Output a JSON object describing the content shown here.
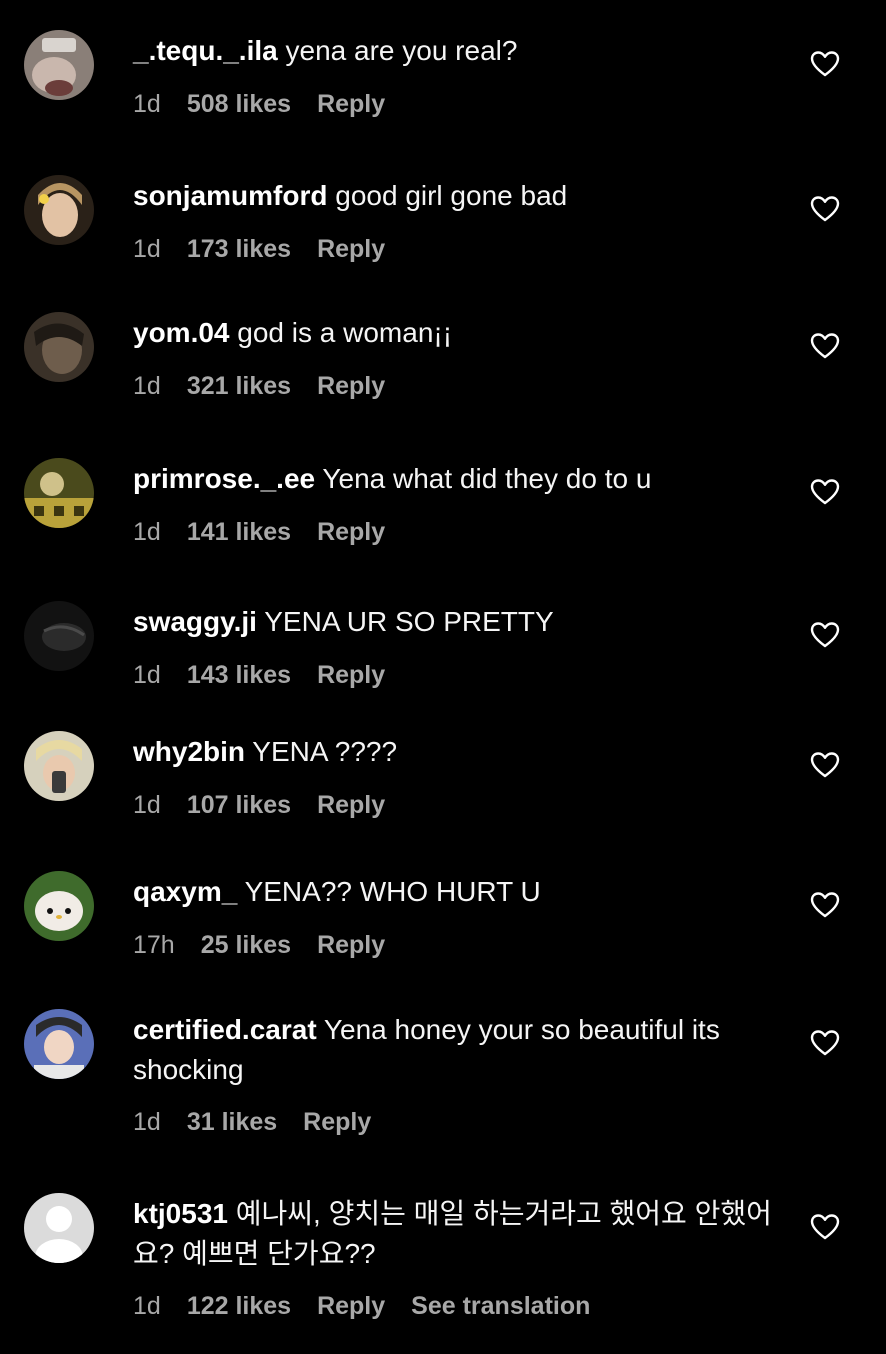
{
  "colors": {
    "background": "#000000",
    "text": "#f5f5f5",
    "secondary_text": "#a8a8a8",
    "heart_outline": "#ffffff"
  },
  "icons": {
    "like": "heart-outline-icon",
    "default_avatar": "default-profile-icon"
  },
  "comments": [
    {
      "username": "_.tequ._.ila",
      "text": "yena are you real?",
      "time": "1d",
      "likes": "508 likes",
      "reply": "Reply"
    },
    {
      "username": "sonjamumford",
      "text": "good girl gone bad",
      "time": "1d",
      "likes": "173 likes",
      "reply": "Reply"
    },
    {
      "username": "yom.04",
      "text": "god is a woman¡¡",
      "time": "1d",
      "likes": "321 likes",
      "reply": "Reply"
    },
    {
      "username": "primrose._.ee",
      "text": "Yena what did they do to u",
      "time": "1d",
      "likes": "141 likes",
      "reply": "Reply"
    },
    {
      "username": "swaggy.ji",
      "text": "YENA UR SO PRETTY",
      "time": "1d",
      "likes": "143 likes",
      "reply": "Reply"
    },
    {
      "username": "why2bin",
      "text": "YENA ????",
      "time": "1d",
      "likes": "107 likes",
      "reply": "Reply"
    },
    {
      "username": "qaxym_",
      "text": "YENA?? WHO HURT U",
      "time": "17h",
      "likes": "25 likes",
      "reply": "Reply"
    },
    {
      "username": "certified.carat",
      "text": "Yena honey your so beautiful its shocking",
      "time": "1d",
      "likes": "31 likes",
      "reply": "Reply"
    },
    {
      "username": "ktj0531",
      "text": "예나씨, 양치는 매일 하는거라고 했어요 안했어요? 예쁘면 단가요??",
      "time": "1d",
      "likes": "122 likes",
      "reply": "Reply",
      "translate": "See translation"
    }
  ]
}
